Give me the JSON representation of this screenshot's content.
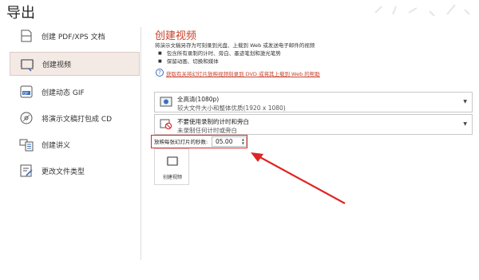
{
  "page": {
    "title": "导出"
  },
  "nav": {
    "items": [
      {
        "label": "创建 PDF/XPS 文档",
        "icon": "document-icon",
        "active": false
      },
      {
        "label": "创建视频",
        "icon": "video-icon",
        "active": true
      },
      {
        "label": "创建动态 GIF",
        "icon": "gif-icon",
        "active": false
      },
      {
        "label": "将演示文稿打包成 CD",
        "icon": "cd-icon",
        "active": false
      },
      {
        "label": "创建讲义",
        "icon": "handout-icon",
        "active": false
      },
      {
        "label": "更改文件类型",
        "icon": "change-file-type-icon",
        "active": false
      }
    ]
  },
  "create_video": {
    "title": "创建视频",
    "description": "将演示文稿另存为可刻录到光盘、上载到 Web 或发送电子邮件的视频",
    "bullets": [
      "包含所有录制的计时、旁白、墨迹笔划和激光笔势",
      "保留动画、切换和媒体"
    ],
    "help_link": "获取有关将幻灯片放映视频刻录到 DVD 或将其上载到 Web 的帮助",
    "quality": {
      "main": "全高清(1080p)",
      "sub": "较大文件大小和整体优质(1920 x 1080)"
    },
    "timing": {
      "main": "不要使用录制的计时和旁白",
      "sub": "未录制任何计时或旁白"
    },
    "seconds_label": "放映每张幻灯片的秒数:",
    "seconds_value": "05.00",
    "create_button": "创建视频"
  },
  "colors": {
    "accent": "#c8402b",
    "highlight": "#e02424",
    "active_bg": "#f3e9e5"
  }
}
